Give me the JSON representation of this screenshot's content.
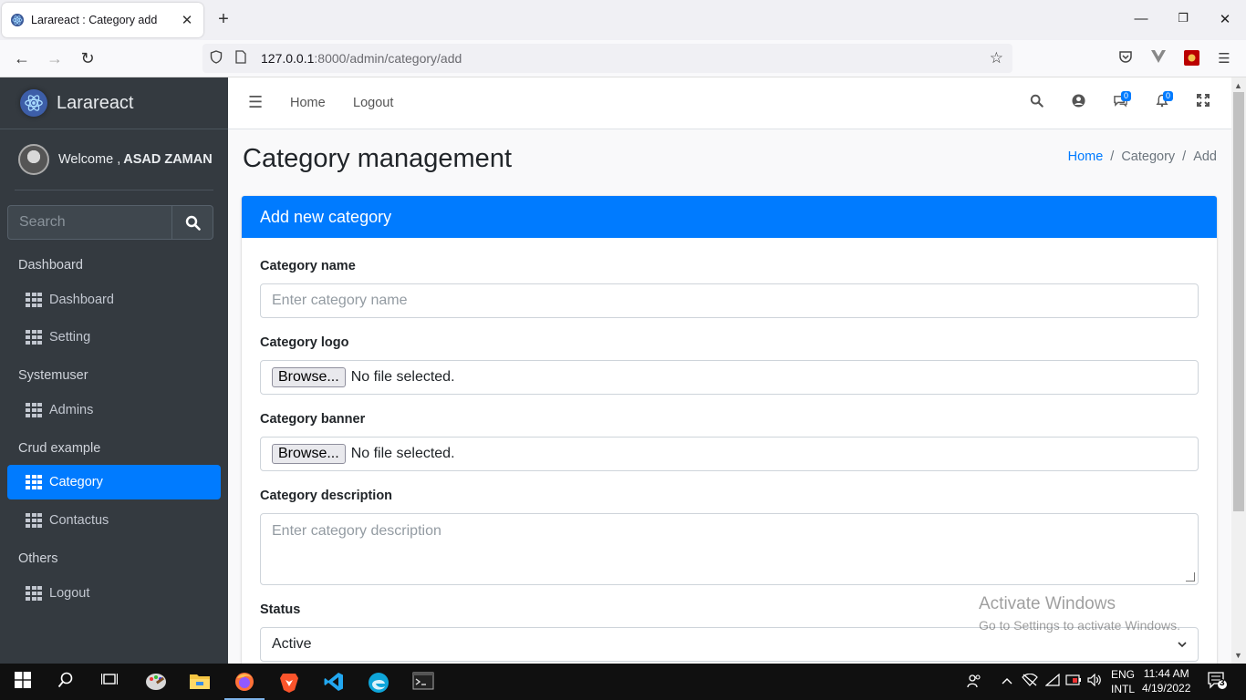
{
  "browser": {
    "tab_title": "Larareact : Category add",
    "tab_close": "✕",
    "new_tab": "+",
    "url_host": "127.0.0.1",
    "url_rest": ":8000/admin/category/add"
  },
  "sidebar": {
    "brand": "Larareact",
    "welcome_prefix": "Welcome ,",
    "user_name": "ASAD ZAMAN",
    "search_placeholder": "Search",
    "sections": [
      {
        "header": "Dashboard",
        "items": [
          "Dashboard",
          "Setting"
        ]
      },
      {
        "header": "Systemuser",
        "items": [
          "Admins"
        ]
      },
      {
        "header": "Crud example",
        "items": [
          "Category",
          "Contactus"
        ]
      },
      {
        "header": "Others",
        "items": [
          "Logout"
        ]
      }
    ],
    "active_item": "Category"
  },
  "topnav": {
    "home": "Home",
    "logout": "Logout",
    "messages_count": "0",
    "notifications_count": "0"
  },
  "page": {
    "title": "Category management",
    "breadcrumb": [
      "Home",
      "Category",
      "Add"
    ],
    "breadcrumb_sep": "/"
  },
  "form": {
    "card_title": "Add new category",
    "name_label": "Category name",
    "name_placeholder": "Enter category name",
    "logo_label": "Category logo",
    "banner_label": "Category banner",
    "browse_label": "Browse...",
    "no_file": "No file selected.",
    "desc_label": "Category description",
    "desc_placeholder": "Enter category description",
    "status_label": "Status",
    "status_value": "Active"
  },
  "watermark": {
    "line1": "Activate Windows",
    "line2": "Go to Settings to activate Windows."
  },
  "taskbar": {
    "lang1": "ENG",
    "lang2": "INTL",
    "time": "11:44 AM",
    "date": "4/19/2022",
    "notif_count": "3"
  },
  "colors": {
    "primary": "#007bff",
    "sidebar_bg": "#343a40"
  }
}
